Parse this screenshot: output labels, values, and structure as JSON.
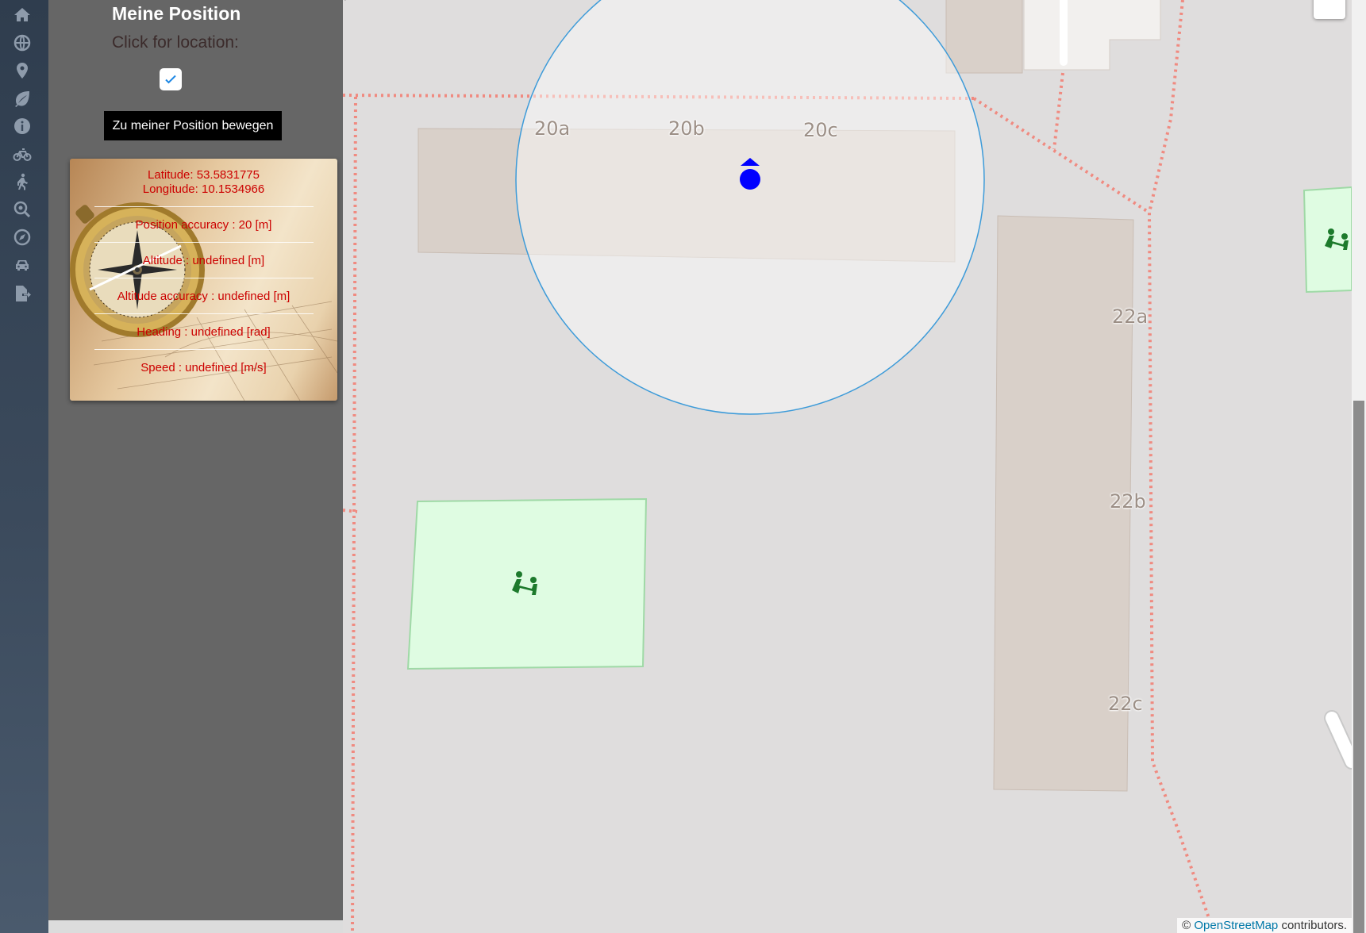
{
  "sidebar": {
    "icons": [
      {
        "name": "home-icon"
      },
      {
        "name": "globe-icon"
      },
      {
        "name": "map-marker-icon"
      },
      {
        "name": "leaf-icon"
      },
      {
        "name": "info-icon"
      },
      {
        "name": "bicycle-icon"
      },
      {
        "name": "hiking-icon"
      },
      {
        "name": "search-location-icon"
      },
      {
        "name": "compass-icon"
      },
      {
        "name": "car-icon"
      },
      {
        "name": "file-export-icon"
      }
    ]
  },
  "panel": {
    "title": "Meine Position",
    "subtitle": "Click for location:",
    "checkbox_checked": true,
    "move_button_label": "Zu meiner Position bewegen",
    "info": {
      "latitude": "Latitude: 53.5831775",
      "longitude": "Longitude: 10.1534966",
      "position_accuracy": "Position accuracy : 20 [m]",
      "altitude": "Altitude : undefined [m]",
      "altitude_accuracy": "Altitude accuracy : undefined [m]",
      "heading": "Heading : undefined [rad]",
      "speed": "Speed : undefined [m/s]"
    }
  },
  "map": {
    "house_numbers": [
      "20a",
      "20b",
      "20c",
      "22a",
      "22b",
      "22c"
    ],
    "attribution_prefix": "©",
    "attribution_link": "OpenStreetMap",
    "attribution_suffix": "contributors.",
    "colors": {
      "background": "#dfdddd",
      "building": "#d9d0c9",
      "playground": "#dffce2",
      "accuracy_circle": "#3388ff",
      "position_marker": "#0000ff",
      "boundary": "#f08080"
    }
  }
}
